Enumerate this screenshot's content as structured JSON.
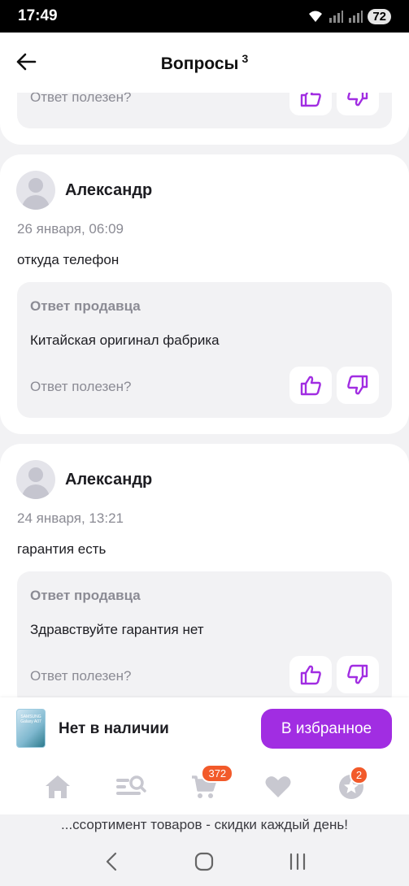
{
  "status_bar": {
    "time": "17:49",
    "battery": "72"
  },
  "header": {
    "title": "Вопросы",
    "count": "3"
  },
  "colors": {
    "accent": "#a12de2",
    "badge": "#f25a2a",
    "muted": "#8b8b94"
  },
  "questions": [
    {
      "helpful_label": "Ответ полезен?"
    },
    {
      "author": "Александр",
      "date": "26 января, 06:09",
      "question": "откуда телефон",
      "answer_label": "Ответ продавца",
      "answer": "Китайская оригинал фабрика",
      "helpful_label": "Ответ полезен?"
    },
    {
      "author": "Александр",
      "date": "24 января, 13:21",
      "question": "гарантия есть",
      "answer_label": "Ответ продавца",
      "answer": "Здравствуйте гарантия нет",
      "helpful_label": "Ответ полезен?"
    }
  ],
  "product_bar": {
    "thumb_text": "SAMSUNG Galaxy A07",
    "stock_status": "Нет в наличии",
    "favorite_button": "В избранное"
  },
  "tab_bar": {
    "items": [
      {
        "icon": "home-icon"
      },
      {
        "icon": "catalog-search-icon"
      },
      {
        "icon": "cart-icon",
        "badge": "372"
      },
      {
        "icon": "heart-icon"
      },
      {
        "icon": "profile-star-icon",
        "badge": "2"
      }
    ]
  },
  "banner": {
    "text": "...ссортимент товаров - скидки каждый день!"
  }
}
